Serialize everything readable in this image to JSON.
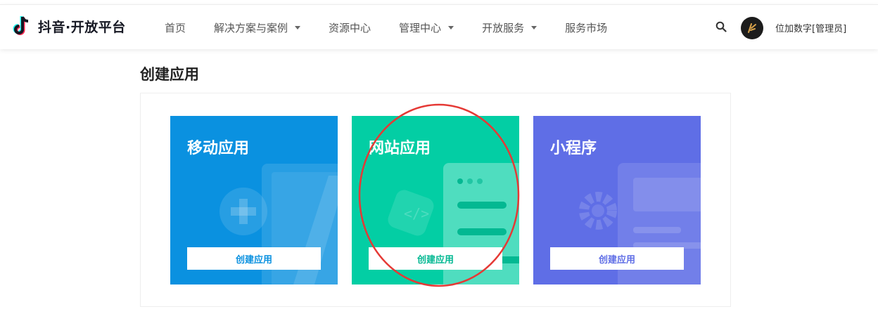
{
  "header": {
    "logo_text": "抖音·开放平台",
    "nav": [
      {
        "label": "首页",
        "has_dropdown": false
      },
      {
        "label": "解决方案与案例",
        "has_dropdown": true
      },
      {
        "label": "资源中心",
        "has_dropdown": false
      },
      {
        "label": "管理中心",
        "has_dropdown": true
      },
      {
        "label": "开放服务",
        "has_dropdown": true
      },
      {
        "label": "服务市场",
        "has_dropdown": false
      }
    ],
    "search_icon": "search-icon",
    "user_name": "位加数字[管理员]"
  },
  "page": {
    "title": "创建应用"
  },
  "cards": [
    {
      "title": "移动应用",
      "button": "创建应用",
      "color": "#0a91e0",
      "icon": "mobile-app-illustration"
    },
    {
      "title": "网站应用",
      "button": "创建应用",
      "color": "#03cea4",
      "icon": "web-app-illustration"
    },
    {
      "title": "小程序",
      "button": "创建应用",
      "color": "#5f6ee6",
      "icon": "mini-program-illustration"
    }
  ],
  "annotation": {
    "color": "#e53935"
  }
}
